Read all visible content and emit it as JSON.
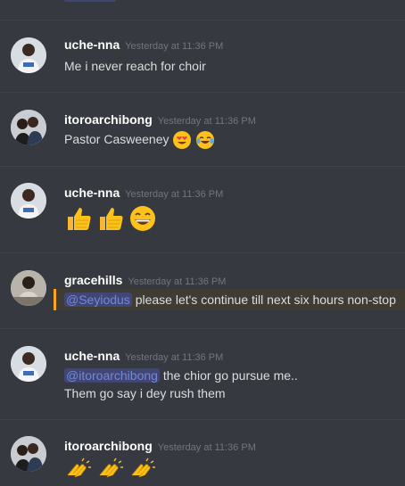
{
  "messages": [
    {
      "username": "uche-nna",
      "timestamp": "Yesterday at 11:36 PM",
      "text": "Me i never reach for choir"
    },
    {
      "username": "itoroarchibong",
      "timestamp": "Yesterday at 11:36 PM",
      "text": "Pastor Casweeney",
      "emojis": [
        "heart-eyes-emoji",
        "joy-emoji"
      ]
    },
    {
      "username": "uche-nna",
      "timestamp": "Yesterday at 11:36 PM",
      "emojis": [
        "thumbs-up-emoji",
        "thumbs-up-emoji",
        "grinning-emoji"
      ]
    },
    {
      "username": "gracehills",
      "timestamp": "Yesterday at 11:36 PM",
      "mention": "@Seyiodus",
      "text": "please let's continue till next six hours non-stop",
      "highlighted": true
    },
    {
      "username": "uche-nna",
      "timestamp": "Yesterday at 11:36 PM",
      "mention": "@itoroarchibong",
      "text": "the chior go pursue me..",
      "text_line2": "Them go say i dey rush them"
    },
    {
      "username": "itoroarchibong",
      "timestamp": "Yesterday at 11:36 PM",
      "emojis": [
        "clap-emoji",
        "clap-emoji",
        "clap-emoji"
      ]
    }
  ],
  "colors": {
    "background": "#36393f",
    "username": "#ffffff",
    "timestamp": "#72767d",
    "mention": "#7289da",
    "highlight_border": "#faa61a"
  }
}
